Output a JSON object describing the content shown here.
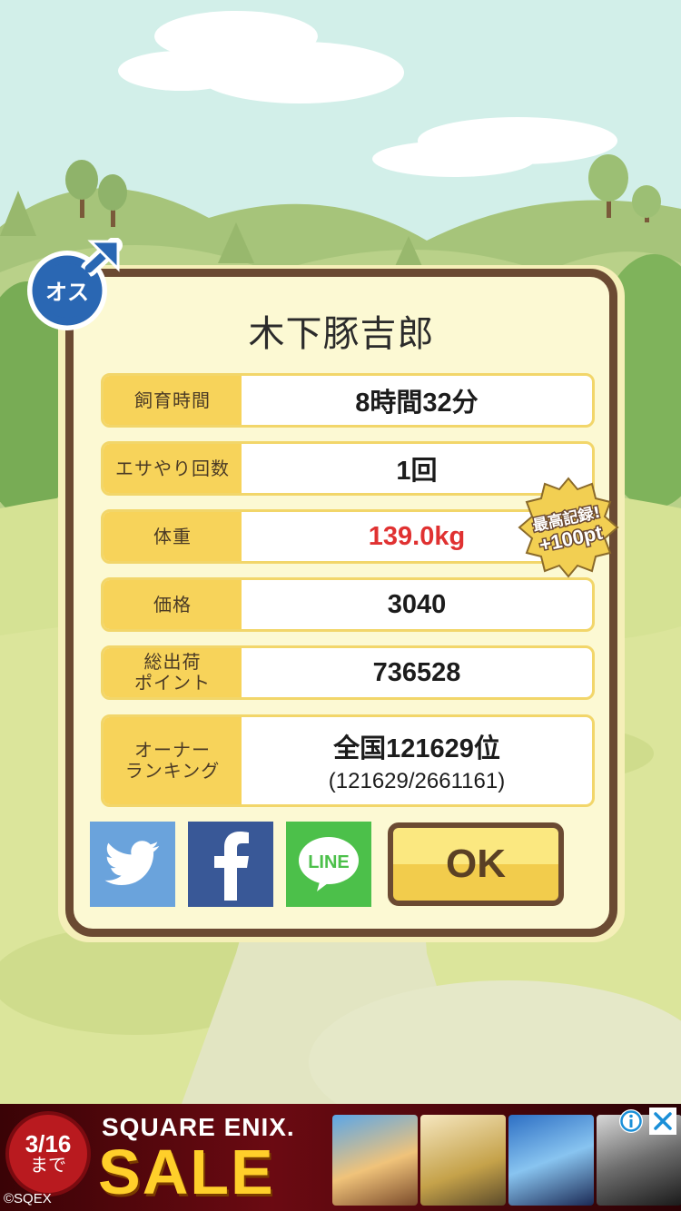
{
  "pig_name": "木下豚吉郎",
  "gender_badge": {
    "label": "オス",
    "icon": "male-symbol-icon"
  },
  "stats": [
    {
      "label": "飼育時間",
      "value": "8時間32分"
    },
    {
      "label": "エサやり回数",
      "value": "1回"
    },
    {
      "label": "体重",
      "value": "139.0kg"
    },
    {
      "label": "価格",
      "value": "3040"
    },
    {
      "label_line1": "総出荷",
      "label_line2": "ポイント",
      "value": "736528"
    },
    {
      "label_line1": "オーナー",
      "label_line2": "ランキング",
      "value": "全国121629位",
      "sub": "(121629/2661161)"
    }
  ],
  "record_badge": {
    "line1": "最高記録!",
    "line2": "+100pt"
  },
  "share": {
    "twitter_icon": "twitter-bird-icon",
    "facebook_icon": "facebook-f-icon",
    "line_label": "LINE"
  },
  "ok_label": "OK",
  "ad": {
    "date": "3/16",
    "until": "まで",
    "brand": "SQUARE ENIX.",
    "sale": "SALE",
    "copyright": "©SQEX",
    "info_icon": "info-icon",
    "close_icon": "close-icon"
  },
  "colors": {
    "accent_label": "#f7d35a",
    "frame_brown": "#6b4a32",
    "record_red": "#e03131",
    "twitter": "#6aa3dc",
    "facebook": "#395897",
    "line": "#4cc04a"
  }
}
